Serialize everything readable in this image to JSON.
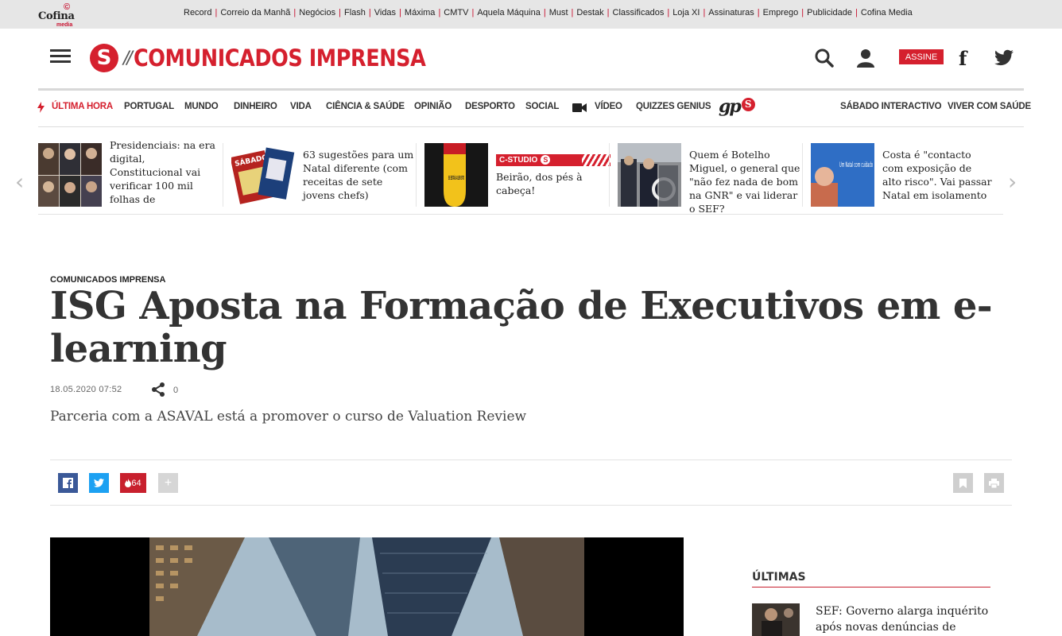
{
  "network": {
    "logo_text": "Cofina",
    "logo_sub": "media",
    "links": [
      "Record",
      "Correio da Manhã",
      "Negócios",
      "Flash",
      "Vidas",
      "Máxima",
      "CMTV",
      "Aquela Máquina",
      "Must",
      "Destak",
      "Classificados",
      "Loja XI",
      "Assinaturas",
      "Emprego",
      "Publicidade",
      "Cofina Media"
    ]
  },
  "header": {
    "brand_letter": "S",
    "brand_slashes": "//",
    "section_title": "COMUNICADOS IMPRENSA",
    "subscribe_label": "ASSINE",
    "facebook_glyph": "f"
  },
  "nav": {
    "items": [
      "ÚLTIMA HORA",
      "PORTUGAL",
      "MUNDO",
      "DINHEIRO",
      "VIDA",
      "CIÊNCIA & SAÚDE",
      "OPINIÃO",
      "DESPORTO",
      "SOCIAL",
      "VÍDEO",
      "QUIZZES GENIUS"
    ],
    "gps_logo": "gp",
    "gps_s": "S",
    "right_items": [
      "SÁBADO INTERACTIVO",
      "VIVER COM SAÚDE"
    ]
  },
  "carousel": {
    "cards": [
      {
        "text": "Presidenciais: na era digital, Constitucional vai verificar 100 mil folhas de"
      },
      {
        "text": "63 sugestões para um Natal diferente (com receitas de sete jovens chefs)"
      },
      {
        "label": "C-STUDIO",
        "label_s": "S",
        "text": "Beirão, dos pés à cabeça!"
      },
      {
        "text": "Quem é Botelho Miguel, o general que \"não fez nada de bom na GNR\" e vai liderar o SEF?"
      },
      {
        "text": "Costa é \"contacto com exposição de alto risco\". Vai passar Natal em isolamento"
      }
    ],
    "thumb_texts": {
      "sabado": "SÁBADO",
      "socks": "SE ESTÁS A LER ISTO",
      "natal": "Um Natal com cuidado"
    }
  },
  "article": {
    "kicker": "COMUNICADOS IMPRENSA",
    "title": "ISG Aposta na Formação de Executivos em e-learning",
    "date": "18.05.2020 07:52",
    "share_count": "0",
    "lead": "Parceria com a ASAVAL está a promover o curso de Valuation Review"
  },
  "toolbar": {
    "fire_count": "64",
    "plus_label": "+"
  },
  "sidebar": {
    "heading": "ÚLTIMAS",
    "first_item": "SEF: Governo alarga inquérito após novas denúncias de"
  },
  "colors": {
    "brand_red": "#d5202e",
    "facebook": "#3b5998",
    "twitter": "#1da1f2"
  }
}
